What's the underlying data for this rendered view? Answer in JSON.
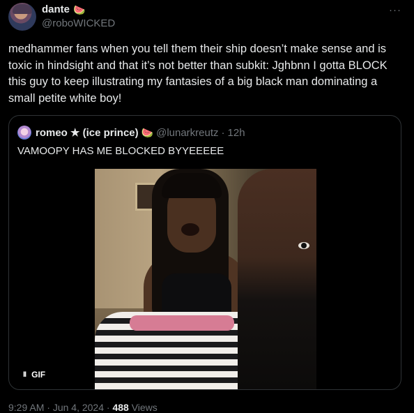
{
  "author": {
    "display_name": "dante",
    "emoji": "🍉",
    "handle": "@roboWICKED"
  },
  "more_icon": "more-horizontal-icon",
  "tweet_text": "medhammer fans when you tell them their ship doesn’t make sense and is toxic in hindsight and that it’s not better than subkit: Jghbnn I gotta BLOCK this guy to keep illustrating my fantasies of a big black man dominating a small petite white boy!",
  "quote": {
    "display_name": "romeo ★ (ice prince)",
    "emoji": "🍉",
    "handle": "@lunarkreutz",
    "dot": "·",
    "time": "12h",
    "text": "VAMOOPY HAS ME BLOCKED BYYEEEEE",
    "media": {
      "type": "gif",
      "pause_glyph": "II",
      "label": "GIF"
    }
  },
  "footer": {
    "time": "9:29 AM",
    "sep1": "·",
    "date": "Jun 4, 2024",
    "sep2": "·",
    "views_count": "488",
    "views_label": "Views"
  }
}
